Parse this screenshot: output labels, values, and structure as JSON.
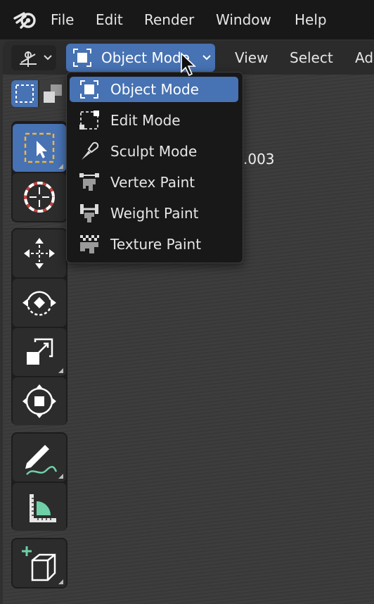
{
  "menubar": {
    "items": [
      "File",
      "Edit",
      "Render",
      "Window",
      "Help"
    ]
  },
  "header": {
    "mode_selected": "Object Mode",
    "menus": [
      "View",
      "Select",
      "Ad"
    ]
  },
  "viewport": {
    "object_name_partial": ".003"
  },
  "mode_menu": {
    "items": [
      {
        "label": "Object Mode",
        "icon": "object-mode-icon",
        "selected": true
      },
      {
        "label": "Edit Mode",
        "icon": "edit-mode-icon",
        "selected": false
      },
      {
        "label": "Sculpt Mode",
        "icon": "sculpt-mode-icon",
        "selected": false
      },
      {
        "label": "Vertex Paint",
        "icon": "vertex-paint-icon",
        "selected": false
      },
      {
        "label": "Weight Paint",
        "icon": "weight-paint-icon",
        "selected": false
      },
      {
        "label": "Texture Paint",
        "icon": "texture-paint-icon",
        "selected": false
      }
    ]
  },
  "toolbar": {
    "tools": [
      "select-box-tool",
      "cursor-tool",
      "move-tool",
      "rotate-tool",
      "scale-tool",
      "transform-tool",
      "annotate-tool",
      "measure-tool",
      "add-cube-tool"
    ],
    "active": "select-box-tool"
  },
  "colors": {
    "accent": "#4772b3",
    "menubar": "#181818",
    "header": "#2b2b2b",
    "viewport": "#3a3a3a",
    "text": "#e6e6e6"
  }
}
